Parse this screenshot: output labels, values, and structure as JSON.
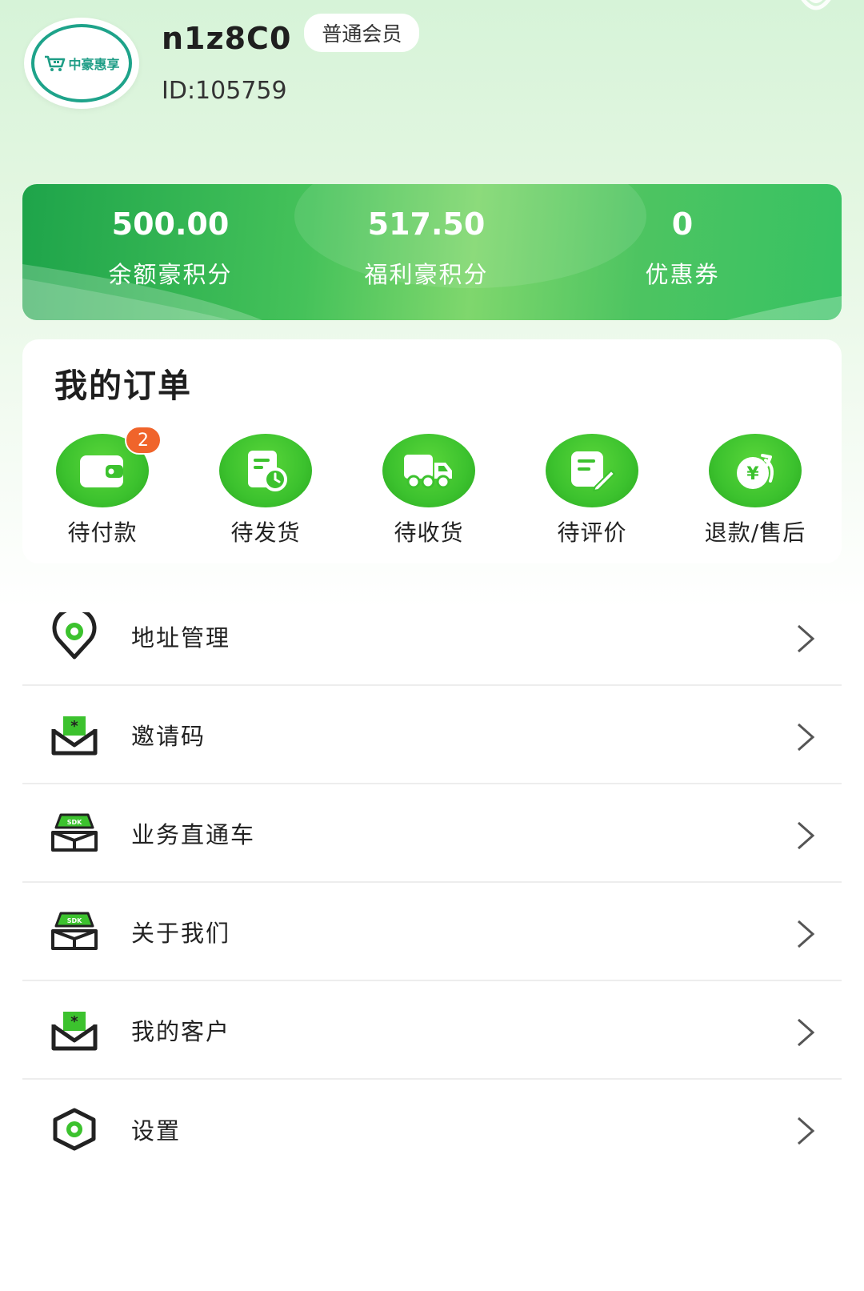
{
  "profile": {
    "logo_text": "中豪惠享",
    "username": "n1z8C0",
    "member_level": "普通会员",
    "user_id": "ID:105759"
  },
  "stats": [
    {
      "value": "500.00",
      "label": "余额豪积分"
    },
    {
      "value": "517.50",
      "label": "福利豪积分"
    },
    {
      "value": "0",
      "label": "优惠券"
    }
  ],
  "orders": {
    "title": "我的订单",
    "items": [
      {
        "label": "待付款",
        "icon": "wallet-icon",
        "badge": "2"
      },
      {
        "label": "待发货",
        "icon": "shipping-doc-icon"
      },
      {
        "label": "待收货",
        "icon": "truck-icon"
      },
      {
        "label": "待评价",
        "icon": "review-pen-icon"
      },
      {
        "label": "退款/售后",
        "icon": "refund-icon"
      }
    ]
  },
  "menu": [
    {
      "label": "地址管理",
      "icon": "location-pin-icon"
    },
    {
      "label": "邀请码",
      "icon": "invite-envelope-icon"
    },
    {
      "label": "业务直通车",
      "icon": "sdk-box-icon"
    },
    {
      "label": "关于我们",
      "icon": "sdk-box-icon"
    },
    {
      "label": "我的客户",
      "icon": "invite-envelope-icon"
    },
    {
      "label": "设置",
      "icon": "settings-hexagon-icon"
    }
  ],
  "colors": {
    "accent_green": "#3cc22e",
    "badge_orange": "#f0642b",
    "logo_teal": "#1ea38a"
  }
}
